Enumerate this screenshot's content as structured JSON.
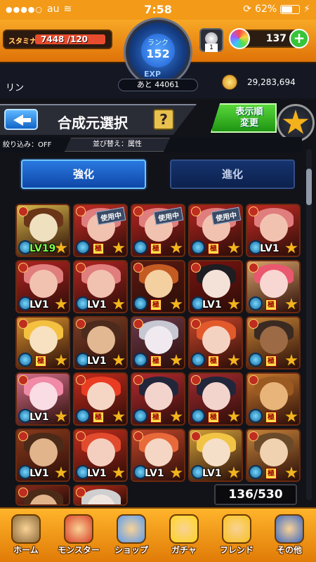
{
  "status": {
    "carrier": "au",
    "time": "7:58",
    "battery": "62%",
    "battery_level": 0.62
  },
  "header": {
    "stamina_label": "スタミナ",
    "stamina": "7448",
    "stamina_max": "/120",
    "rank_label": "ランク",
    "rank": "152",
    "exp_label": "EXP",
    "exp_remaining": "あと 44061",
    "potion_count": "1",
    "orbs": "137",
    "player_name": "リン",
    "gold": "29,283,694"
  },
  "title": {
    "text": "合成元選択",
    "help": "?",
    "sort_button": "表示順\n変更"
  },
  "filters": {
    "narrow": "絞り込み：OFF",
    "sort": "並び替え：属性"
  },
  "tabs": [
    {
      "label": "強化"
    },
    {
      "label": "進化"
    }
  ],
  "monsters": [
    {
      "lvl": "LV19",
      "badge": "",
      "inuse": "",
      "colors": [
        "#d6b64a",
        "#efe0c0",
        "#6b3518"
      ]
    },
    {
      "lvl": "",
      "badge": "極",
      "inuse": "使用中",
      "colors": [
        "#c62b25",
        "#f2c2b0",
        "#e07d7d"
      ]
    },
    {
      "lvl": "",
      "badge": "極",
      "inuse": "使用中",
      "colors": [
        "#b42421",
        "#f2c2b0",
        "#e07d7d"
      ]
    },
    {
      "lvl": "",
      "badge": "極",
      "inuse": "使用中",
      "colors": [
        "#b42421",
        "#f2c2b0",
        "#e07d7d"
      ]
    },
    {
      "lvl": "LV1",
      "badge": "",
      "inuse": "",
      "colors": [
        "#c62b25",
        "#f2c2b0",
        "#e07d7d"
      ]
    },
    {
      "lvl": "LV1",
      "badge": "",
      "inuse": "",
      "colors": [
        "#b12422",
        "#f2c2b0",
        "#e07d7d"
      ]
    },
    {
      "lvl": "LV1",
      "badge": "",
      "inuse": "",
      "colors": [
        "#b12422",
        "#f2c2b0",
        "#e07d7d"
      ]
    },
    {
      "lvl": "",
      "badge": "極",
      "inuse": "",
      "colors": [
        "#5a1a12",
        "#f4d0a0",
        "#c45b22"
      ]
    },
    {
      "lvl": "LV1",
      "badge": "",
      "inuse": "",
      "colors": [
        "#7b1410",
        "#f4e2d8",
        "#1d1d22"
      ]
    },
    {
      "lvl": "",
      "badge": "極",
      "inuse": "",
      "colors": [
        "#d9a26a",
        "#f8d6d2",
        "#e9586f"
      ]
    },
    {
      "lvl": "",
      "badge": "極",
      "inuse": "",
      "colors": [
        "#d7912e",
        "#f7e1c0",
        "#f4c040"
      ]
    },
    {
      "lvl": "LV1",
      "badge": "",
      "inuse": "",
      "colors": [
        "#7a4028",
        "#e2b892",
        "#4c2a1c"
      ]
    },
    {
      "lvl": "",
      "badge": "極",
      "inuse": "",
      "colors": [
        "#6a3a4c",
        "#f0eaf0",
        "#c7c7d2"
      ]
    },
    {
      "lvl": "",
      "badge": "極",
      "inuse": "",
      "colors": [
        "#c8452a",
        "#f4d2c2",
        "#e2592c"
      ]
    },
    {
      "lvl": "",
      "badge": "極",
      "inuse": "",
      "colors": [
        "#c48234",
        "#9c6a44",
        "#3a2a22"
      ]
    },
    {
      "lvl": "LV1",
      "badge": "",
      "inuse": "",
      "colors": [
        "#d66f8c",
        "#f9dce4",
        "#f08aa6"
      ]
    },
    {
      "lvl": "",
      "badge": "極",
      "inuse": "",
      "colors": [
        "#c62a1c",
        "#f5d6c4",
        "#ea3c22"
      ]
    },
    {
      "lvl": "",
      "badge": "極",
      "inuse": "",
      "colors": [
        "#b32a30",
        "#f2d4cc",
        "#22263a"
      ]
    },
    {
      "lvl": "",
      "badge": "極",
      "inuse": "",
      "colors": [
        "#a32a30",
        "#f2d4cc",
        "#22263a"
      ]
    },
    {
      "lvl": "",
      "badge": "極",
      "inuse": "",
      "colors": [
        "#c97a2e",
        "#e8b47a",
        "#9a5a22"
      ]
    },
    {
      "lvl": "LV1",
      "badge": "",
      "inuse": "",
      "colors": [
        "#8a3a1c",
        "#e2b48c",
        "#4b2a18"
      ]
    },
    {
      "lvl": "LV1",
      "badge": "",
      "inuse": "",
      "colors": [
        "#c42c1c",
        "#f4cfc0",
        "#e24a2e"
      ]
    },
    {
      "lvl": "LV1",
      "badge": "",
      "inuse": "",
      "colors": [
        "#c2462a",
        "#f5d6c4",
        "#e86a3a"
      ]
    },
    {
      "lvl": "LV1",
      "badge": "",
      "inuse": "",
      "colors": [
        "#d1a03a",
        "#f6dfc8",
        "#f1c445"
      ]
    },
    {
      "lvl": "",
      "badge": "極",
      "inuse": "",
      "colors": [
        "#c6843a",
        "#f0d2b0",
        "#6b4a2a"
      ]
    },
    {
      "lvl": "",
      "badge": "",
      "inuse": "",
      "colors": [
        "#8a2a1c",
        "#e2b48c",
        "#4b2a18"
      ]
    },
    {
      "lvl": "",
      "badge": "",
      "inuse": "",
      "colors": [
        "#c42c1c",
        "#f0e6e0",
        "#cfcfcf"
      ]
    }
  ],
  "box_count": "136/530",
  "nav": [
    {
      "label": "ホーム",
      "icon": "home-icon",
      "color": "#8b6a3a"
    },
    {
      "label": "モンスター",
      "icon": "monster-icon",
      "color": "#d8402a"
    },
    {
      "label": "ショップ",
      "icon": "shop-orb-icon",
      "color": "#5a9cf0"
    },
    {
      "label": "ガチャ",
      "icon": "gacha-egg-icon",
      "color": "#ffd51e"
    },
    {
      "label": "フレンド",
      "icon": "friend-balloon-icon",
      "color": "#f7c21f"
    },
    {
      "label": "その他",
      "icon": "other-icon",
      "color": "#3d6ac4"
    }
  ]
}
